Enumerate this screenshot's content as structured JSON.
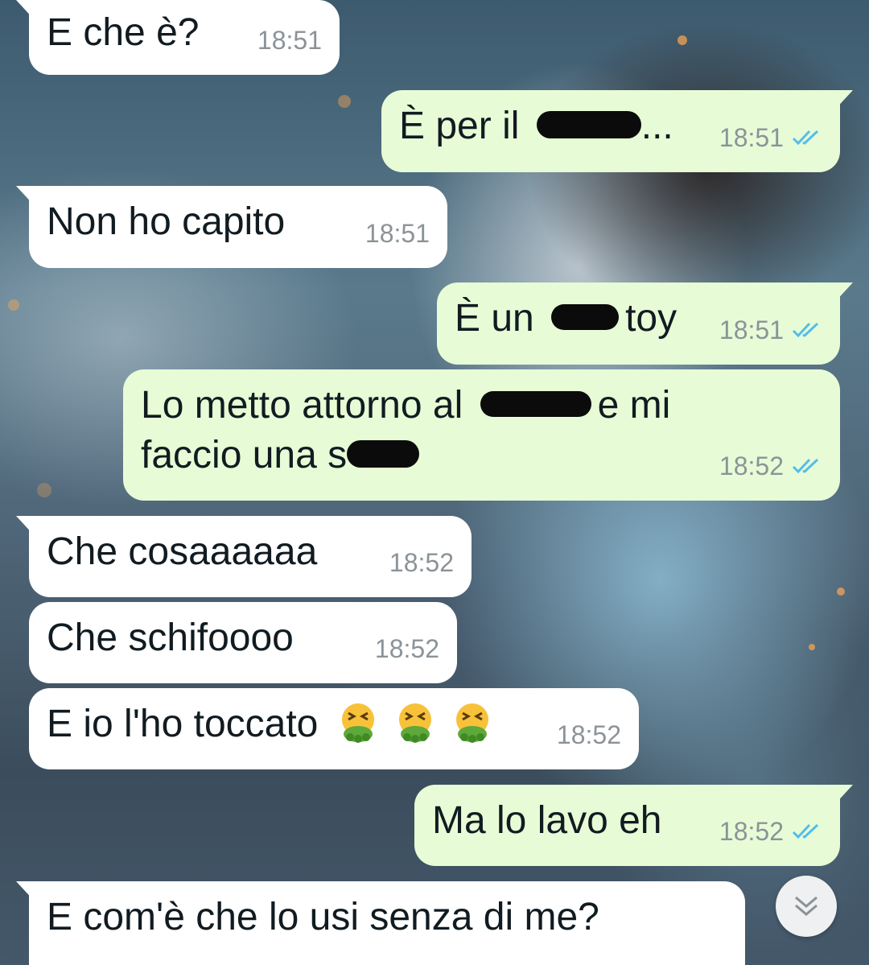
{
  "chat": {
    "messages": [
      {
        "text": "E che è?",
        "time": "18:51"
      },
      {
        "text_before": "È per il",
        "text_after": "...",
        "time": "18:51"
      },
      {
        "text": "Non ho capito",
        "time": "18:51"
      },
      {
        "text_before": "È un",
        "text_after": "toy",
        "time": "18:51"
      },
      {
        "line1_before": "Lo metto attorno al",
        "line1_after": "e mi",
        "line2_before": "faccio una s",
        "time": "18:52"
      },
      {
        "text": "Che cosaaaaaa",
        "time": "18:52"
      },
      {
        "text": "Che schifoooo",
        "time": "18:52"
      },
      {
        "text": "E io l'ho toccato",
        "emoji": "face-vomiting",
        "time": "18:52"
      },
      {
        "text": "Ma lo lavo eh",
        "time": "18:52"
      },
      {
        "text": "E com'è che lo usi senza di me?"
      }
    ]
  },
  "colors": {
    "incoming_bubble": "#ffffff",
    "outgoing_bubble": "#e7fcd6",
    "read_ticks": "#53bdeb",
    "timestamp": "#8b9398"
  },
  "icons": {
    "read_receipt": "double-check-icon",
    "scroll_down": "chevron-double-down-icon"
  }
}
